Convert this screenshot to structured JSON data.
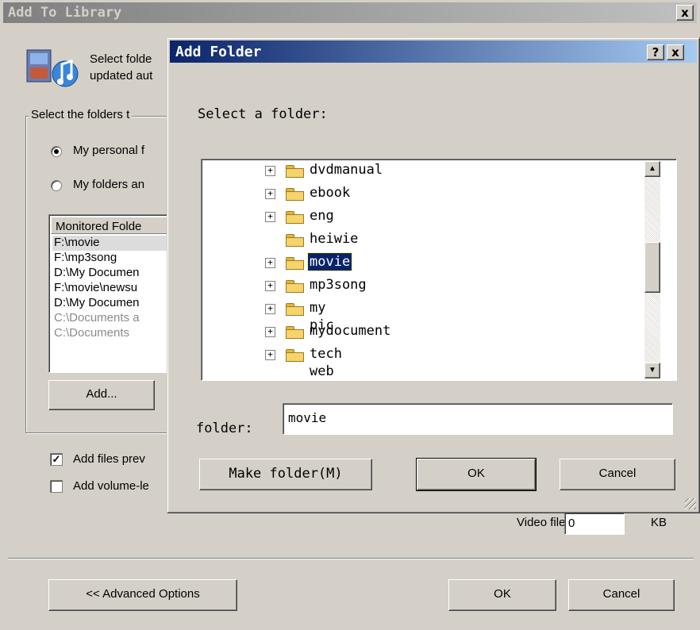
{
  "outer": {
    "title": "Add To Library",
    "close_label": "x",
    "intro_line1": "Select folde",
    "intro_line2": "updated aut",
    "group_legend": "Select the folders t",
    "radio1_label": "My personal f",
    "radio2_label": "My folders an",
    "list_header": "Monitored Folde",
    "list_rows": [
      "F:\\movie",
      "F:\\mp3song",
      "D:\\My Documen",
      "F:\\movie\\newsu",
      "D:\\My Documen",
      "C:\\Documents a",
      "C:\\Documents"
    ],
    "add_button": "Add...",
    "check1_label": "Add files prev",
    "check2_label": "Add volume-le",
    "video_files_label": "Video files:",
    "video_files_value": "0",
    "kb_label": "KB",
    "advanced_button": "<< Advanced Options",
    "ok_button": "OK",
    "cancel_button": "Cancel"
  },
  "dialog": {
    "title": "Add Folder",
    "help_label": "?",
    "close_label": "x",
    "prompt": "Select a folder:",
    "tree_items": [
      {
        "label": "dvdmanual",
        "expandable": true
      },
      {
        "label": "ebook",
        "expandable": true
      },
      {
        "label": "eng",
        "expandable": true
      },
      {
        "label": "heiwie",
        "expandable": false
      },
      {
        "label": "movie",
        "expandable": true
      },
      {
        "label": "mp3song",
        "expandable": true
      },
      {
        "label": "my pic",
        "expandable": true
      },
      {
        "label": "mydocument",
        "expandable": true
      },
      {
        "label": "tech web",
        "expandable": true
      }
    ],
    "selected_index": 4,
    "folder_label": "folder:",
    "folder_value": "movie",
    "make_folder_button": "Make folder(M)",
    "ok_button": "OK",
    "cancel_button": "Cancel"
  },
  "colors": {
    "active_title_start": "#0a246a",
    "active_title_end": "#a6caf0",
    "face": "#d4d0c8",
    "folder": "#f6d36b"
  }
}
